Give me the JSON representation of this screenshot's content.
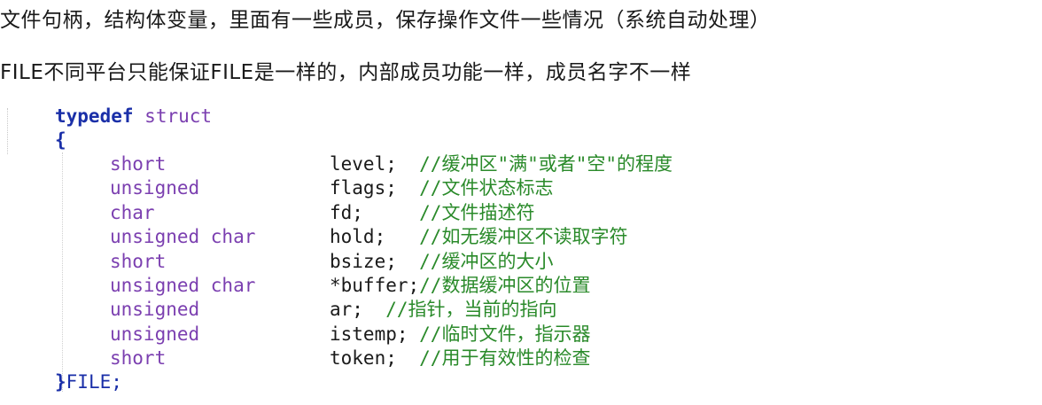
{
  "text": {
    "line1": "文件句柄，结构体变量，里面有一些成员，保存操作文件一些情况（系统自动处理）",
    "line2": "FILE不同平台只能保证FILE是一样的，内部成员功能一样，成员名字不一样"
  },
  "code": {
    "typedef_kw": "typedef",
    "struct_kw": "struct",
    "open_brace": "{",
    "close_brace": "}",
    "tail_name": "FILE;",
    "members": [
      {
        "type": "short",
        "decl": "level;  ",
        "comment": "//缓冲区\"满\"或者\"空\"的程度"
      },
      {
        "type": "unsigned",
        "decl": "flags;  ",
        "comment": "//文件状态标志"
      },
      {
        "type": "char",
        "decl": "fd;     ",
        "comment": "//文件描述符"
      },
      {
        "type": "unsigned char",
        "decl": "hold;   ",
        "comment": "//如无缓冲区不读取字符"
      },
      {
        "type": "short",
        "decl": "bsize;  ",
        "comment": "//缓冲区的大小"
      },
      {
        "type": "unsigned char",
        "decl": "*buffer;",
        "comment": "//数据缓冲区的位置"
      },
      {
        "type": "unsigned",
        "decl": "ar;  ",
        "comment": "//指针，当前的指向"
      },
      {
        "type": "unsigned",
        "decl": "istemp; ",
        "comment": "//临时文件，指示器"
      },
      {
        "type": "short",
        "decl": "token;  ",
        "comment": "//用于有效性的检查"
      }
    ]
  }
}
